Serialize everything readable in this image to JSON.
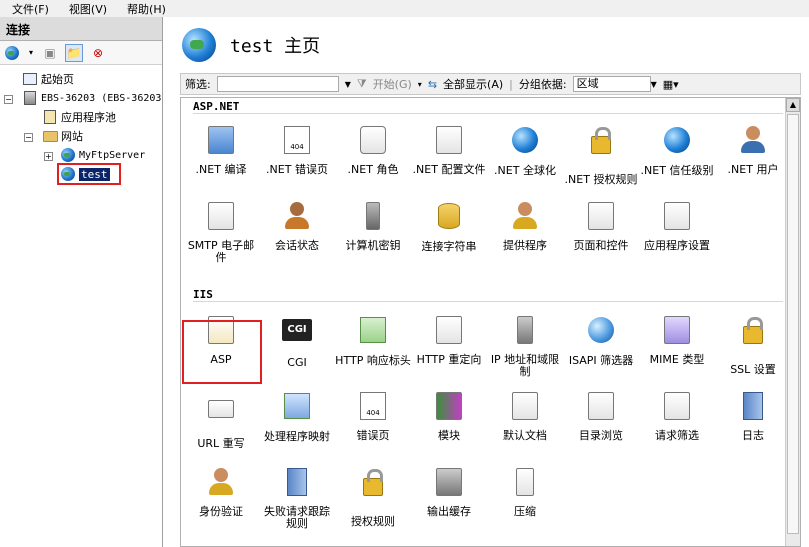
{
  "menu": [
    "文件(F)",
    "视图(V)",
    "帮助(H)"
  ],
  "left": {
    "title": "连接",
    "tree": {
      "start_page": "起始页",
      "server": "EBS-36203 (EBS-36203",
      "app_pools": "应用程序池",
      "sites": "网站",
      "site1": "MyFtpServer",
      "site2": "test"
    }
  },
  "right": {
    "title": "test 主页",
    "filter": {
      "label": "筛选:",
      "start": "开始(G)",
      "show_all": "全部显示(A)",
      "group_by": "分组依据:",
      "group_value": "区域"
    },
    "sections": {
      "aspnet": "ASP.NET",
      "iis": "IIS"
    },
    "aspnet_items": [
      ".NET 编译",
      ".NET 错误页",
      ".NET 角色",
      ".NET 配置文件",
      ".NET 全球化",
      ".NET 授权规则",
      ".NET 信任级别",
      ".NET 用户",
      "SMTP 电子邮件",
      "会话状态",
      "计算机密钥",
      "连接字符串",
      "提供程序",
      "页面和控件",
      "应用程序设置"
    ],
    "iis_items": [
      "ASP",
      "CGI",
      "HTTP 响应标头",
      "HTTP 重定向",
      "IP 地址和域限制",
      "ISAPI 筛选器",
      "MIME 类型",
      "SSL 设置",
      "URL 重写",
      "处理程序映射",
      "错误页",
      "模块",
      "默认文档",
      "目录浏览",
      "请求筛选",
      "日志",
      "身份验证",
      "失败请求跟踪规则",
      "授权规则",
      "输出缓存",
      "压缩"
    ],
    "cgi_text": "CGI",
    "err_text": "404"
  }
}
